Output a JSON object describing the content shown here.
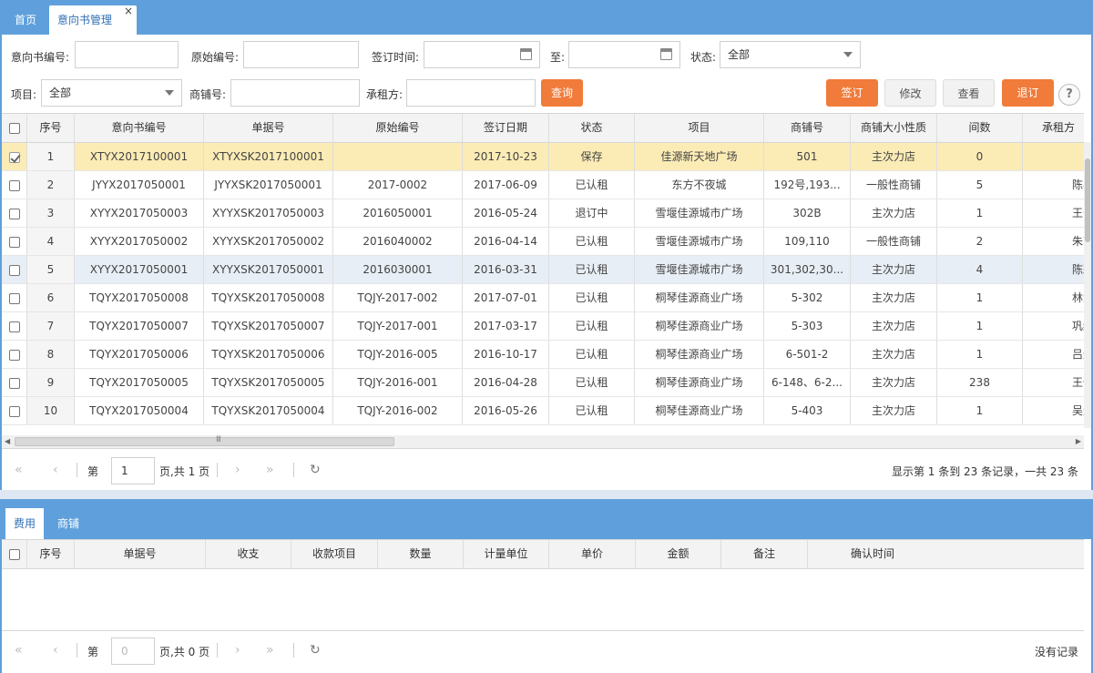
{
  "tabs": {
    "home": "首页",
    "active": "意向书管理",
    "close": "×"
  },
  "search": {
    "intent_no_label": "意向书编号:",
    "orig_no_label": "原始编号:",
    "sign_time_label": "签订时间:",
    "to_label": "至:",
    "status_label": "状态:",
    "status_value": "全部",
    "project_label": "项目:",
    "project_value": "全部",
    "shop_no_label": "商铺号:",
    "tenant_label": "承租方:",
    "query_button": "查询"
  },
  "actions": {
    "sign": "签订",
    "modify": "修改",
    "view": "查看",
    "cancel": "退订",
    "help": "?"
  },
  "main_table": {
    "columns": [
      "序号",
      "意向书编号",
      "单据号",
      "原始编号",
      "签订日期",
      "状态",
      "项目",
      "商铺号",
      "商铺大小性质",
      "间数",
      "承租方"
    ],
    "rows": [
      {
        "no": "1",
        "intent": "XTYX2017100001",
        "doc": "XTYXSK2017100001",
        "orig": "",
        "date": "2017-10-23",
        "status": "保存",
        "project": "佳源新天地广场",
        "shop": "501",
        "nature": "主次力店",
        "count": "0",
        "tenant": ""
      },
      {
        "no": "2",
        "intent": "JYYX2017050001",
        "doc": "JYYXSK2017050001",
        "orig": "2017-0002",
        "date": "2017-06-09",
        "status": "已认租",
        "project": "东方不夜城",
        "shop": "192号,193...",
        "nature": "一般性商铺",
        "count": "5",
        "tenant": "陈兵"
      },
      {
        "no": "3",
        "intent": "XYYX2017050003",
        "doc": "XYYXSK2017050003",
        "orig": "2016050001",
        "date": "2016-05-24",
        "status": "退订中",
        "project": "雪堰佳源城市广场",
        "shop": "302B",
        "nature": "主次力店",
        "count": "1",
        "tenant": "王云"
      },
      {
        "no": "4",
        "intent": "XYYX2017050002",
        "doc": "XYYXSK2017050002",
        "orig": "2016040002",
        "date": "2016-04-14",
        "status": "已认租",
        "project": "雪堰佳源城市广场",
        "shop": "109,110",
        "nature": "一般性商铺",
        "count": "2",
        "tenant": "朱高"
      },
      {
        "no": "5",
        "intent": "XYYX2017050001",
        "doc": "XYYXSK2017050001",
        "orig": "2016030001",
        "date": "2016-03-31",
        "status": "已认租",
        "project": "雪堰佳源城市广场",
        "shop": "301,302,30...",
        "nature": "主次力店",
        "count": "4",
        "tenant": "陈彩"
      },
      {
        "no": "6",
        "intent": "TQYX2017050008",
        "doc": "TQYXSK2017050008",
        "orig": "TQJY-2017-002",
        "date": "2017-07-01",
        "status": "已认租",
        "project": "桐琴佳源商业广场",
        "shop": "5-302",
        "nature": "主次力店",
        "count": "1",
        "tenant": "林金"
      },
      {
        "no": "7",
        "intent": "TQYX2017050007",
        "doc": "TQYXSK2017050007",
        "orig": "TQJY-2017-001",
        "date": "2017-03-17",
        "status": "已认租",
        "project": "桐琴佳源商业广场",
        "shop": "5-303",
        "nature": "主次力店",
        "count": "1",
        "tenant": "巩红"
      },
      {
        "no": "8",
        "intent": "TQYX2017050006",
        "doc": "TQYXSK2017050006",
        "orig": "TQJY-2016-005",
        "date": "2016-10-17",
        "status": "已认租",
        "project": "桐琴佳源商业广场",
        "shop": "6-501-2",
        "nature": "主次力店",
        "count": "1",
        "tenant": "吕炜"
      },
      {
        "no": "9",
        "intent": "TQYX2017050005",
        "doc": "TQYXSK2017050005",
        "orig": "TQJY-2016-001",
        "date": "2016-04-28",
        "status": "已认租",
        "project": "桐琴佳源商业广场",
        "shop": "6-148、6-2...",
        "nature": "主次力店",
        "count": "238",
        "tenant": "王健"
      },
      {
        "no": "10",
        "intent": "TQYX2017050004",
        "doc": "TQYXSK2017050004",
        "orig": "TQJY-2016-002",
        "date": "2016-05-26",
        "status": "已认租",
        "project": "桐琴佳源商业广场",
        "shop": "5-403",
        "nature": "主次力店",
        "count": "1",
        "tenant": "吴光"
      }
    ]
  },
  "pager_main": {
    "page_label": "第",
    "page_value": "1",
    "total_label": "页,共 1 页",
    "info": "显示第 1 条到 23 条记录，一共 23 条"
  },
  "sub_tabs": {
    "fee": "费用",
    "shop": "商铺"
  },
  "sub_table": {
    "columns": [
      "序号",
      "单据号",
      "收支",
      "收款项目",
      "数量",
      "计量单位",
      "单价",
      "金额",
      "备注",
      "确认时间"
    ]
  },
  "pager_sub": {
    "page_label": "第",
    "page_value": "0",
    "total_label": "页,共 0 页",
    "info": "没有记录"
  },
  "colors": {
    "blue": "#5fa0dc",
    "orange": "#f07b3a",
    "selected_row": "#fbebb5"
  }
}
